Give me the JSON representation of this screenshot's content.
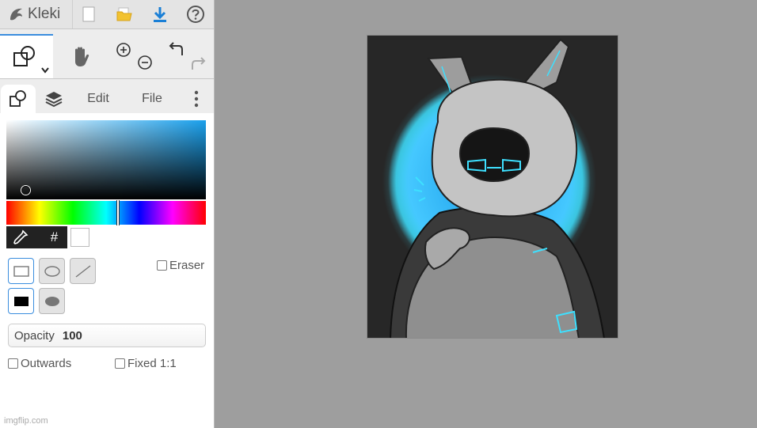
{
  "app": {
    "logo_text": "Kleki"
  },
  "toolbar": {
    "buttons": [
      "new-file-icon",
      "open-folder-icon",
      "download-icon",
      "help-icon"
    ]
  },
  "tools": {
    "active": "shapes-tool",
    "items": [
      "shapes-tool",
      "hand-tool",
      "zoom-in",
      "zoom-out",
      "undo",
      "redo"
    ]
  },
  "tabs": {
    "edit_label": "Edit",
    "file_label": "File"
  },
  "shape_options": {
    "eraser_label": "Eraser",
    "opacity_label": "Opacity",
    "opacity_value": "100",
    "outwards_label": "Outwards",
    "fixed_label": "Fixed 1:1",
    "hex_symbol": "#"
  },
  "colors": {
    "accent": "#3a8dde",
    "current_color": "#ffffff",
    "sv_hue": "#1aa0ec",
    "glow": "#3ee0ff"
  },
  "watermark": "imgflip.com"
}
